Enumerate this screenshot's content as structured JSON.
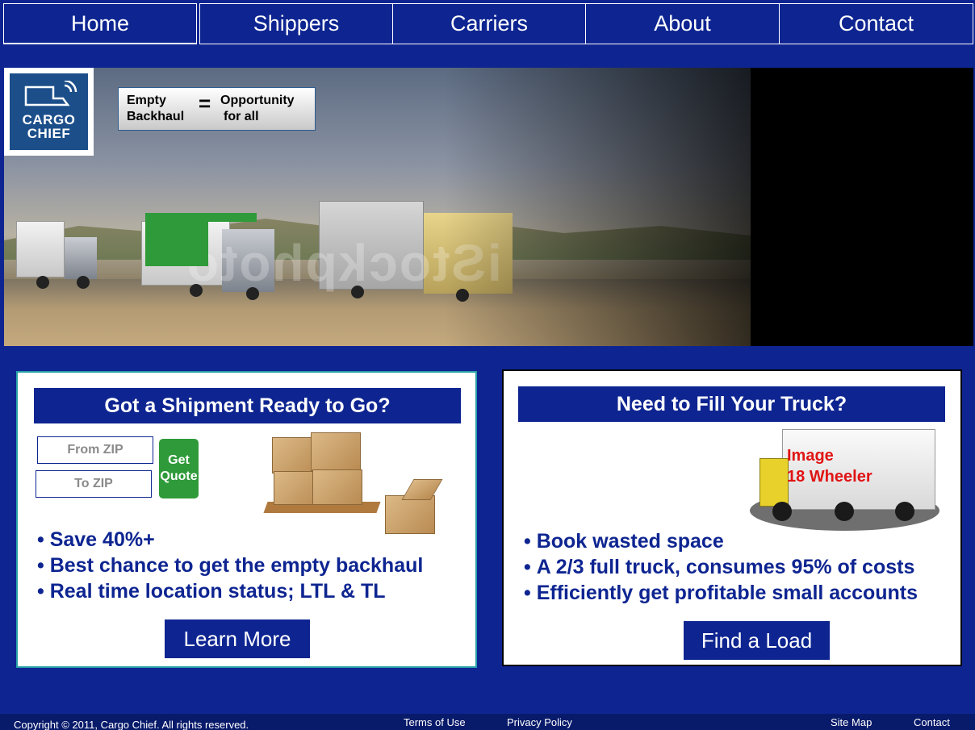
{
  "nav": {
    "items": [
      {
        "label": "Home"
      },
      {
        "label": "Shippers"
      },
      {
        "label": "Carriers"
      },
      {
        "label": "About"
      },
      {
        "label": "Contact"
      }
    ]
  },
  "hero": {
    "logo_line1": "CARGO",
    "logo_line2": "CHIEF",
    "callout_left_1": "Empty",
    "callout_left_2": "Backhaul",
    "callout_equals": "=",
    "callout_right_1": "Opportunity",
    "callout_right_2": "for all",
    "watermark": "iStockphoto"
  },
  "shippers_panel": {
    "title": "Got a Shipment Ready to Go?",
    "from_zip_placeholder": "From ZIP",
    "to_zip_placeholder": "To ZIP",
    "quote_line1": "Get",
    "quote_line2": "Quote",
    "bullets": [
      "Save 40%+",
      "Best chance to get the empty backhaul",
      "Real time location status; LTL & TL"
    ],
    "button_label": "Learn More"
  },
  "carriers_panel": {
    "title": "Need to Fill Your Truck?",
    "image_label_1": "Image",
    "image_label_2": "18 Wheeler",
    "bullets": [
      "Book wasted space",
      "A 2/3 full truck, consumes 95% of costs",
      "Efficiently get profitable small accounts"
    ],
    "button_label": "Find a Load"
  },
  "footer": {
    "copyright": "Copyright © 2011, Cargo Chief. All rights reserved.",
    "terms": "Terms of Use",
    "privacy": "Privacy Policy",
    "sitemap": "Site Map",
    "contact": "Contact"
  },
  "colors": {
    "navy": "#0e2591",
    "green": "#2f9a3a",
    "teal_border": "#27a0a8",
    "highlight_red": "#e01414"
  }
}
